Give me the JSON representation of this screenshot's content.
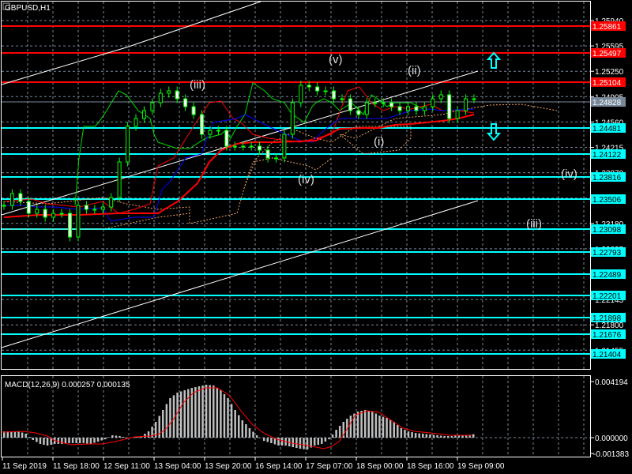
{
  "chart_data": [
    {
      "type": "candlestick",
      "title": "GBPUSD,H1",
      "symbol": "GBPUSD",
      "timeframe": "H1",
      "ylim": [
        1.213,
        1.2618
      ],
      "y_ticks": [
        "1.25940",
        "1.25595",
        "1.25250",
        "1.24905",
        "1.24560",
        "1.24215",
        "1.23870",
        "1.23525",
        "1.23180",
        "1.22835",
        "1.22490",
        "1.22145",
        "1.21800",
        "1.21455"
      ],
      "x_tick_labels": [
        "11 Sep 2019",
        "11 Sep 18:00",
        "12 Sep 11:00",
        "13 Sep 04:00",
        "13 Sep 20:00",
        "16 Sep 14:00",
        "17 Sep 07:00",
        "18 Sep 00:00",
        "18 Sep 16:00",
        "19 Sep 09:00"
      ],
      "closes": [
        1.23425,
        1.23586,
        1.23479,
        1.23317,
        1.23371,
        1.23264,
        1.23317,
        1.23317,
        1.22995,
        1.23425,
        1.23371,
        1.23371,
        1.23403,
        1.23532,
        1.24016,
        1.245,
        1.24607,
        1.24715,
        1.24822,
        1.24951,
        1.24983,
        1.24876,
        1.24768,
        1.24661,
        1.24392,
        1.24446,
        1.24446,
        1.24231,
        1.24231,
        1.24231,
        1.24231,
        1.24177,
        1.2407,
        1.2407,
        1.24392,
        1.24822,
        1.25059,
        1.25037,
        1.24983,
        1.24983,
        1.24876,
        1.24876,
        1.24715,
        1.24661,
        1.24822,
        1.24822,
        1.24822,
        1.24768,
        1.24715,
        1.24768,
        1.24715,
        1.24768,
        1.24876,
        1.2493,
        1.24607,
        1.24715,
        1.24876,
        1.24876
      ],
      "horizontal_levels": [
        {
          "price": "1.25861",
          "color": "#ff0000"
        },
        {
          "price": "1.25497",
          "color": "#ff0000"
        },
        {
          "price": "1.25104",
          "color": "#ff0000"
        },
        {
          "price": "1.24828",
          "color": "#778899"
        },
        {
          "price": "1.24481",
          "color": "#00ffff"
        },
        {
          "price": "1.24122",
          "color": "#00ffff"
        },
        {
          "price": "1.23816",
          "color": "#00ffff"
        },
        {
          "price": "1.23506",
          "color": "#00ffff"
        },
        {
          "price": "1.23098",
          "color": "#00ffff"
        },
        {
          "price": "1.22793",
          "color": "#00ffff"
        },
        {
          "price": "1.22489",
          "color": "#00ffff"
        },
        {
          "price": "1.22201",
          "color": "#00ffff"
        },
        {
          "price": "1.21898",
          "color": "#00ffff"
        },
        {
          "price": "1.21676",
          "color": "#00ffff"
        },
        {
          "price": "1.21404",
          "color": "#00ffff"
        }
      ],
      "wave_labels": [
        "(iii)",
        "(v)",
        "(ii)",
        "(i)",
        "(iv)",
        "(iv)",
        "(iii)"
      ]
    },
    {
      "type": "bar",
      "title": "MACD(12,26,9) 0.000257 0.000135",
      "ylim": [
        -0.001383,
        0.004194
      ],
      "y_ticks": [
        "0.004194",
        "0.000000",
        "-0.001383"
      ],
      "histogram": [
        0.00047,
        0.00047,
        0.00047,
        0.0003,
        -0.00018,
        -0.00047,
        -0.00059,
        -0.00047,
        -0.00047,
        -0.00041,
        -0.00041,
        -0.00041,
        -0.00047,
        -0.0003,
        -0.00012,
        0.00018,
        0.00012,
        0,
        0,
        0.00012,
        0.00047,
        0.00118,
        0.00207,
        0.00296,
        0.00337,
        0.00355,
        0.00372,
        0.00384,
        0.00396,
        0.0039,
        0.00355,
        0.00296,
        0.00207,
        0.0013,
        0.00071,
        0.00018,
        -0.00024,
        -0.00041,
        -0.00059,
        -0.00059,
        -0.00071,
        -0.00083,
        -0.00089,
        -0.00059,
        -0.00047,
        -0.00012,
        0.00059,
        0.00118,
        0.00165,
        0.00195,
        0.00207,
        0.00195,
        0.00165,
        0.00148,
        0.00118,
        0.00071,
        0.00047,
        0.00035,
        0.0003,
        0.00024,
        0.00018,
        0.00012,
        0.00012,
        0.00018,
        0.00018,
        0.000257
      ]
    }
  ]
}
